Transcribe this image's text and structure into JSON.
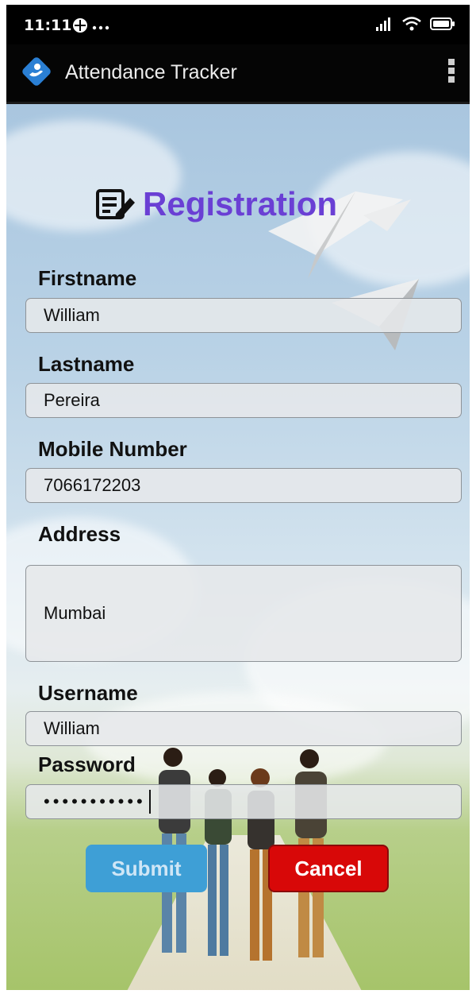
{
  "status_bar": {
    "time": "11:11"
  },
  "app_bar": {
    "title": "Attendance Tracker"
  },
  "form": {
    "heading": "Registration",
    "fields": {
      "firstname": {
        "label": "Firstname",
        "value": "William"
      },
      "lastname": {
        "label": "Lastname",
        "value": "Pereira"
      },
      "mobile": {
        "label": "Mobile Number",
        "value": "7066172203"
      },
      "address": {
        "label": "Address",
        "value": "Mumbai"
      },
      "username": {
        "label": "Username",
        "value": "William"
      },
      "password": {
        "label": "Password",
        "value": "•••••••••••"
      }
    },
    "submit_label": "Submit",
    "cancel_label": "Cancel"
  },
  "colors": {
    "heading": "#6a3fd4",
    "submit": "#3e9fd6",
    "cancel": "#d80808",
    "appbar": "#050505"
  },
  "icons": {
    "app_logo": "hand-logo-icon",
    "overflow": "more-vert-icon",
    "heading": "edit-note-icon"
  }
}
